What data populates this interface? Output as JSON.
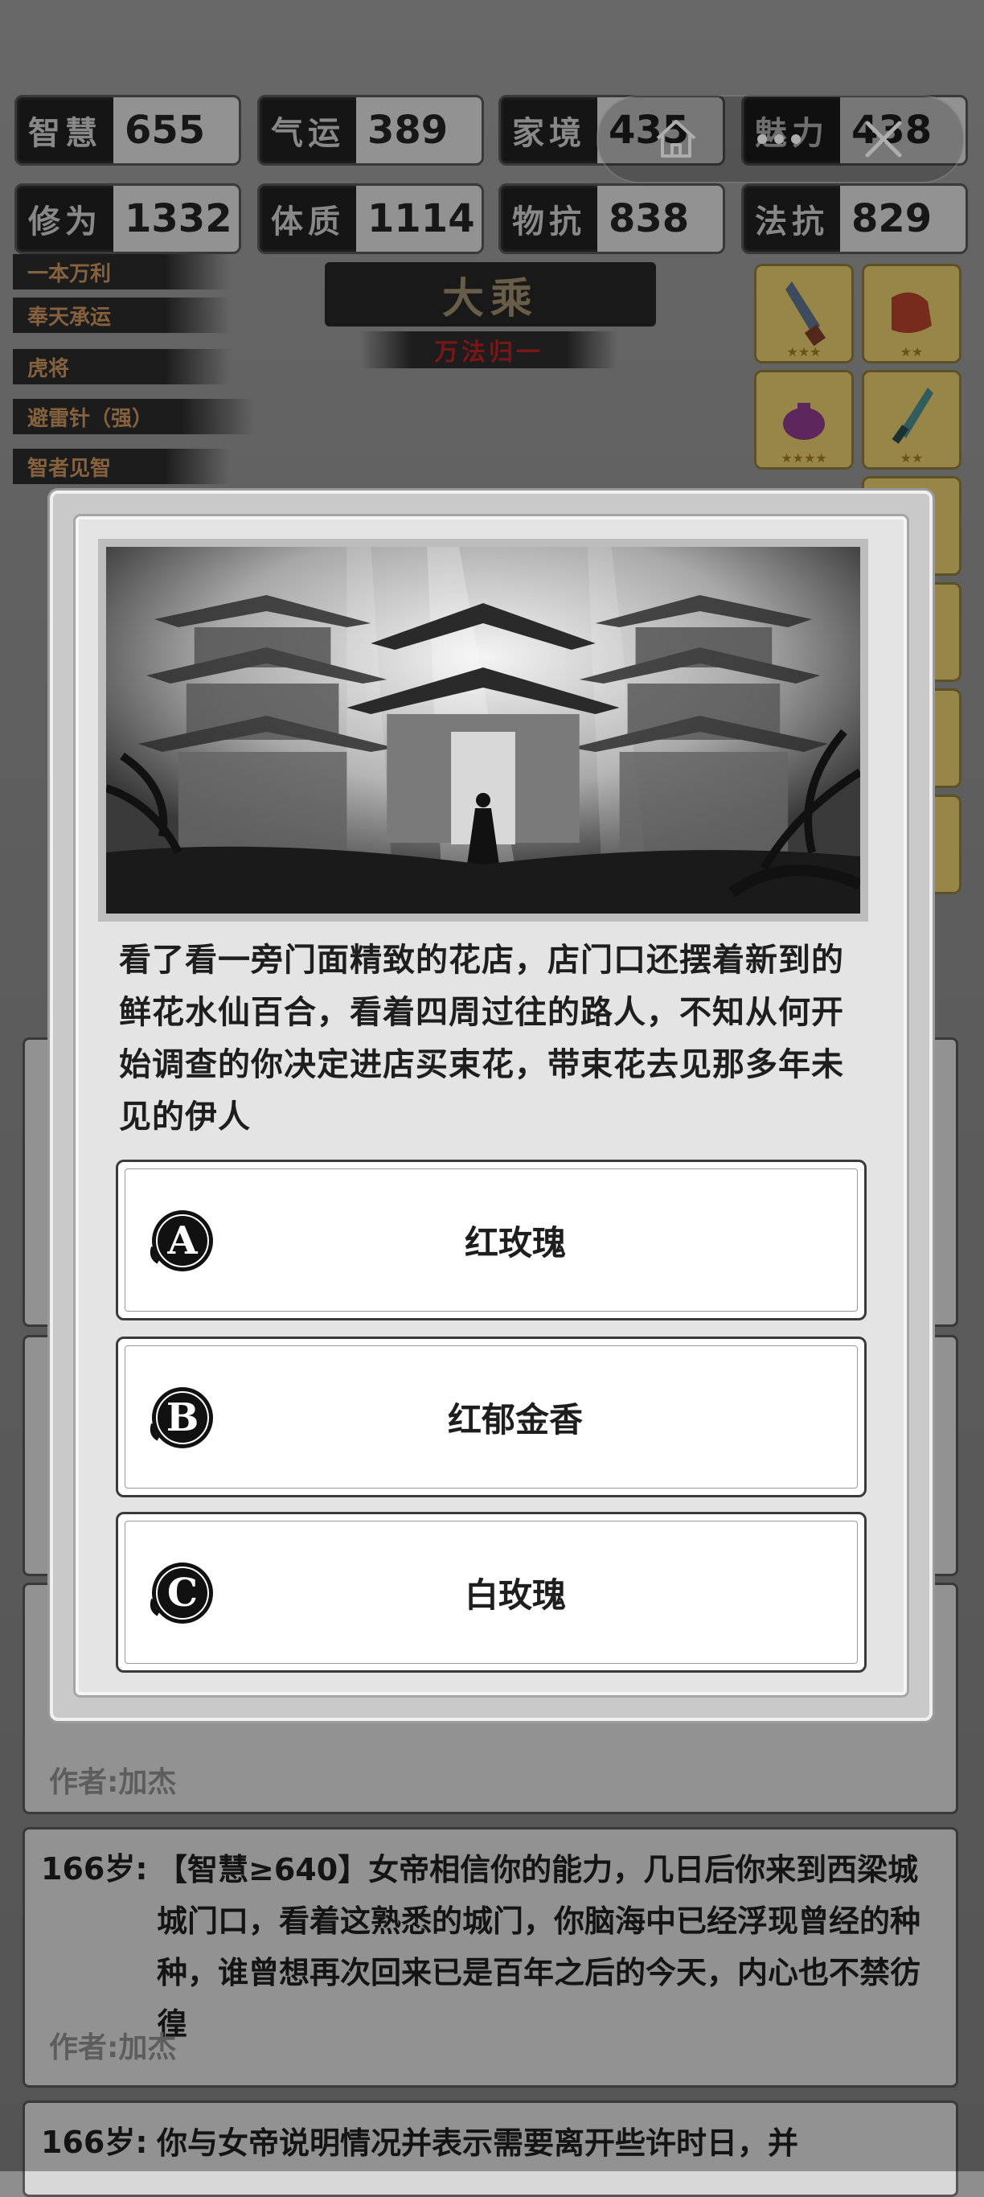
{
  "stats_row1": [
    {
      "key": "智慧",
      "value": "655"
    },
    {
      "key": "气运",
      "value": "389"
    },
    {
      "key": "家境",
      "value": "435"
    },
    {
      "key": "魅力",
      "value": "438"
    }
  ],
  "stats_row2": [
    {
      "key": "修为",
      "value": "1332"
    },
    {
      "key": "体质",
      "value": "1114"
    },
    {
      "key": "物抗",
      "value": "838"
    },
    {
      "key": "法抗",
      "value": "829"
    }
  ],
  "skills": [
    "一本万利",
    "奉天承运",
    "虎将",
    "避雷针（强）",
    "智者见智"
  ],
  "realm": {
    "title": "大乘",
    "subtitle": "万法归一"
  },
  "item_stars": [
    "★★★",
    "★★",
    "★★★★",
    "★★"
  ],
  "logs": [
    {
      "author": "作者:加杰"
    },
    {
      "age": "166岁:",
      "text": "【智慧≥640】女帝相信你的能力，几日后你来到西梁城城门口，看着这熟悉的城门，你脑海中已经浮现曾经的种种，谁曾想再次回来已是百年之后的今天，内心也不禁彷徨",
      "author": "作者:加杰"
    },
    {
      "age": "166岁:",
      "text": "你与女帝说明情况并表示需要离开些许时日，并"
    }
  ],
  "event": {
    "story": "看了看一旁门面精致的花店，店门口还摆着新到的鲜花水仙百合，看着四周过往的路人，不知从何开始调查的你决定进店买束花，带束花去见那多年未见的伊人",
    "options": [
      {
        "letter": "A",
        "label": "红玫瑰"
      },
      {
        "letter": "B",
        "label": "红郁金香"
      },
      {
        "letter": "C",
        "label": "白玫瑰"
      }
    ]
  },
  "colors": {
    "skill_text": "#c6905a",
    "realm_subtitle": "#b22222",
    "item_slot": "#e1c46a"
  }
}
